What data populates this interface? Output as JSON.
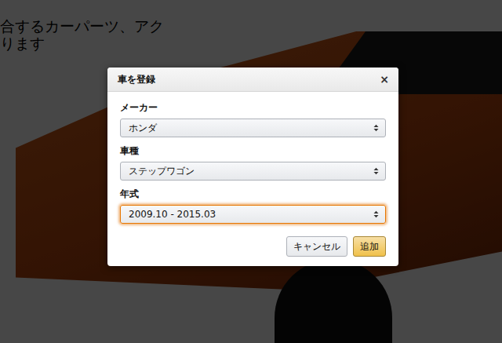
{
  "background": {
    "heading_lines": [
      "合するカーパーツ、アク",
      "ります"
    ]
  },
  "dialog": {
    "title": "車を登録",
    "close": "×",
    "fields": [
      {
        "label": "メーカー",
        "value": "ホンダ",
        "focused": false
      },
      {
        "label": "車種",
        "value": "ステップワゴン",
        "focused": false
      },
      {
        "label": "年式",
        "value": "2009.10 - 2015.03",
        "focused": true
      }
    ],
    "buttons": [
      {
        "label": "キャンセル",
        "kind": "secondary"
      },
      {
        "label": "追加",
        "kind": "primary"
      }
    ]
  }
}
